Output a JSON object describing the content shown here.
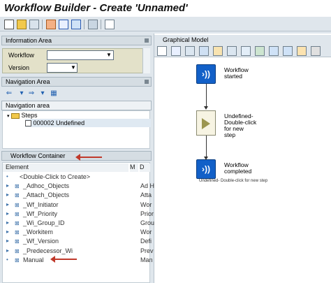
{
  "window": {
    "title": "Workflow Builder - Create 'Unnamed'"
  },
  "toolbar": {
    "icons": [
      "new-icon",
      "open-icon",
      "other-icon",
      "activate-icon",
      "edit-icon",
      "sync-icon",
      "print-icon",
      "layout-icon"
    ]
  },
  "info_area": {
    "header": "Information Area",
    "workflow_label": "Workflow",
    "workflow_value": "",
    "version_label": "Version",
    "version_value": ""
  },
  "navigation_area": {
    "header": "Navigation Area",
    "tree_header": "Navigation area",
    "nodes": [
      {
        "label": "Steps",
        "icon": "folder-icon"
      },
      {
        "label": "000002 Undefined",
        "icon": "step-icon"
      }
    ]
  },
  "workflow_container": {
    "header": "Workflow Container",
    "columns": [
      "Element",
      "M",
      "D"
    ],
    "rows": [
      {
        "element": "<Double-Click to Create>",
        "m": "",
        "d": ""
      },
      {
        "element": "_Adhoc_Objects",
        "m": "",
        "d": "Ad H"
      },
      {
        "element": "_Attach_Objects",
        "m": "",
        "d": "Atta"
      },
      {
        "element": "_Wf_Initiator",
        "m": "",
        "d": "Wor"
      },
      {
        "element": "_Wf_Priority",
        "m": "",
        "d": "Prior"
      },
      {
        "element": "_Wi_Group_ID",
        "m": "",
        "d": "Grou"
      },
      {
        "element": "_Workitem",
        "m": "",
        "d": "Wor"
      },
      {
        "element": "_Wf_Version",
        "m": "",
        "d": "Defi"
      },
      {
        "element": "_Predecessor_Wi",
        "m": "",
        "d": "Prev"
      },
      {
        "element": "Manual",
        "m": "",
        "d": "Man"
      }
    ]
  },
  "graphical_model": {
    "header": "Graphical Model",
    "nodes": [
      {
        "label_lines": [
          "Workflow",
          "started"
        ],
        "type": "event"
      },
      {
        "label_lines": [
          "Undefined-",
          "Double-click",
          "for new",
          "step"
        ],
        "type": "undefined"
      },
      {
        "label_lines": [
          "Workflow",
          "completed"
        ],
        "type": "event"
      }
    ],
    "edge_label": "Undefined- Double-click for new step"
  },
  "colors": {
    "panel": "#dfe6ec",
    "event_blue": "#1260c8",
    "arrow_red": "#c0392b"
  }
}
